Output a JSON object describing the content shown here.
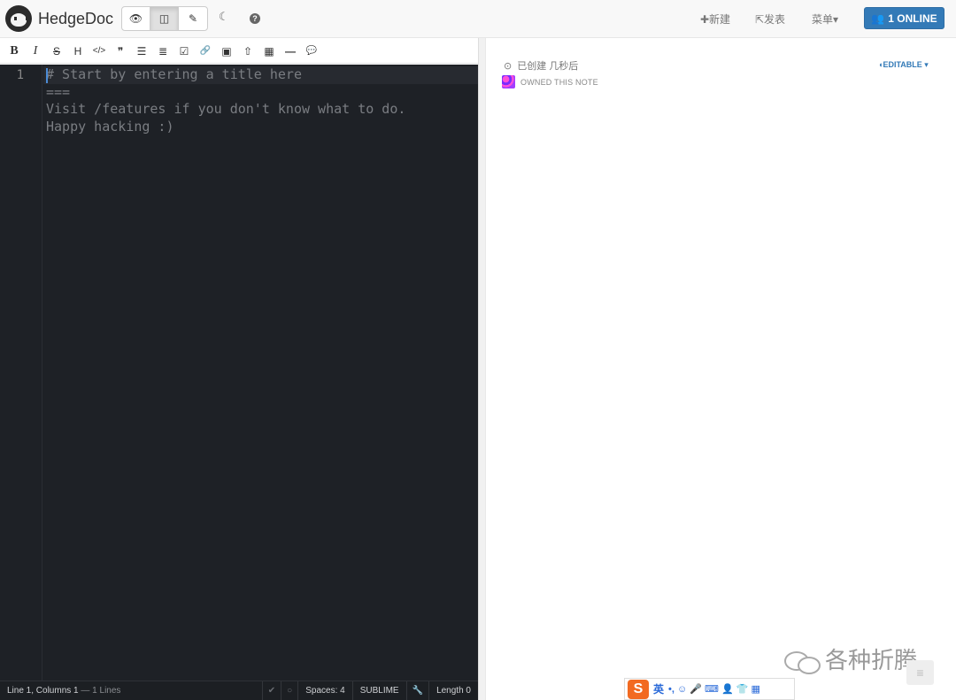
{
  "brand": {
    "name": "HedgeDoc"
  },
  "mode_buttons": [
    {
      "icon": "eye-icon",
      "glyph": "👁",
      "active": false
    },
    {
      "icon": "columns-icon",
      "glyph": "◫",
      "active": true
    },
    {
      "icon": "pencil-icon",
      "glyph": "✎",
      "active": false
    }
  ],
  "nav": {
    "night_glyph": "☾",
    "help_glyph": "?",
    "new_label": "✚新建",
    "publish_label": "⇱发表",
    "menu_label": "菜单▾",
    "online_label": "1 ONLINE"
  },
  "toolbar": {
    "bold": "B",
    "italic": "I",
    "strike": "S",
    "header": "H",
    "code": "</>",
    "quote": "❞",
    "unordered_list": "☰",
    "ordered_list": "≣",
    "check": "☑",
    "link": "🔗",
    "image": "▣",
    "upload": "⇧",
    "table": "▦",
    "line": "—",
    "comment": "💬"
  },
  "editor": {
    "line_number": "1",
    "lines": [
      "# Start by entering a title here",
      "===",
      "Visit /features if you don't know what to do.",
      "Happy hacking :)"
    ]
  },
  "status": {
    "position": "Line 1, Columns 1",
    "lines": "— 1 Lines",
    "spaces": "Spaces: 4",
    "keymap": "SUBLIME",
    "length": "Length 0"
  },
  "preview": {
    "created": "已创建 几秒后",
    "owner": "OWNED THIS NOTE",
    "permission": "EDITABLE ▾"
  },
  "overlay": {
    "watermark": "各种折腾",
    "ime_logo": "S",
    "ime_lang": "英",
    "ime_items": "•, ☺ 🎤 ⌨ 👤 👕 ▦"
  }
}
